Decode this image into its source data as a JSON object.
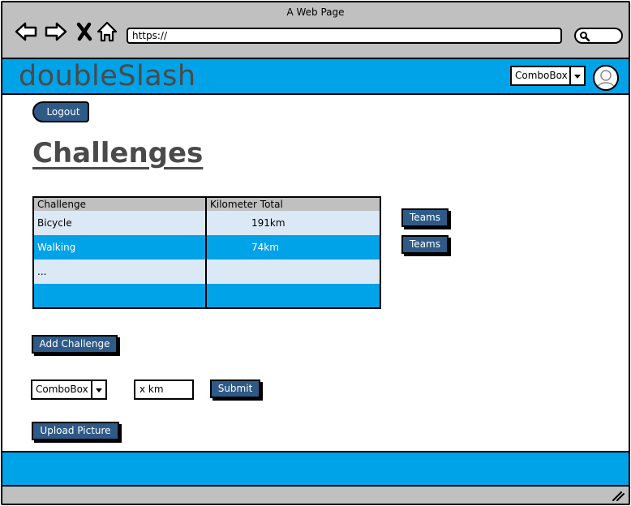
{
  "window": {
    "title": "A Web Page"
  },
  "browser": {
    "url": "https://"
  },
  "header": {
    "logo": "doubleSlash",
    "combo_value": "ComboBox"
  },
  "page": {
    "logout_label": "Logout",
    "title": "Challenges"
  },
  "table": {
    "columns": [
      "Challenge",
      "Kilometer Total"
    ],
    "rows": [
      {
        "challenge": "Bicycle",
        "km": "191km"
      },
      {
        "challenge": "Walking",
        "km": "74km"
      },
      {
        "challenge": "...",
        "km": ""
      },
      {
        "challenge": "",
        "km": ""
      }
    ],
    "team_buttons": [
      "Teams",
      "Teams"
    ]
  },
  "actions": {
    "add_challenge": "Add Challenge",
    "combo_value": "ComboBox",
    "km_value": "x km",
    "submit": "Submit",
    "upload_picture": "Upload Picture"
  },
  "colors": {
    "accent": "#00a2e8",
    "button": "#2e5a88",
    "chrome": "#c0c0c0"
  }
}
